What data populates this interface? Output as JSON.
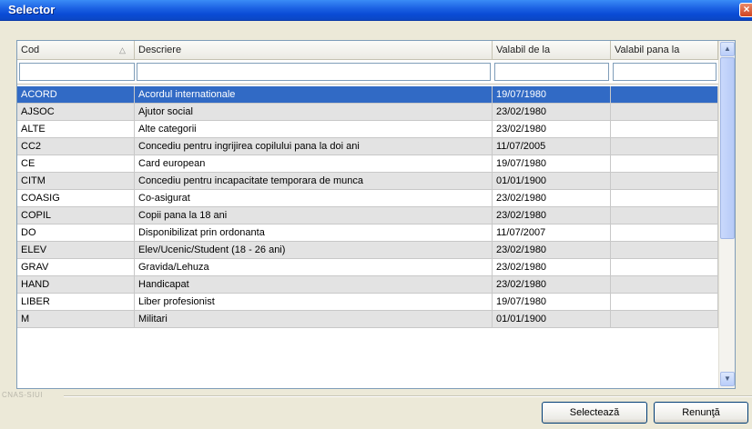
{
  "window": {
    "title": "Selector",
    "close_glyph": "×"
  },
  "table": {
    "columns": [
      {
        "label": "Cod",
        "sort": "ascending"
      },
      {
        "label": "Descriere"
      },
      {
        "label": "Valabil de la"
      },
      {
        "label": "Valabil pana la"
      }
    ],
    "filters": [
      "",
      "",
      "",
      ""
    ],
    "selected_index": 0,
    "rows": [
      {
        "cod": "ACORD",
        "descriere": "Acordul internationale",
        "de_la": "19/07/1980",
        "pana_la": ""
      },
      {
        "cod": "AJSOC",
        "descriere": "Ajutor social",
        "de_la": "23/02/1980",
        "pana_la": ""
      },
      {
        "cod": "ALTE",
        "descriere": "Alte categorii",
        "de_la": "23/02/1980",
        "pana_la": ""
      },
      {
        "cod": "CC2",
        "descriere": "Concediu pentru ingrijirea copilului pana la doi ani",
        "de_la": "11/07/2005",
        "pana_la": ""
      },
      {
        "cod": "CE",
        "descriere": "Card european",
        "de_la": "19/07/1980",
        "pana_la": ""
      },
      {
        "cod": "CITM",
        "descriere": "Concediu pentru incapacitate temporara de munca",
        "de_la": "01/01/1900",
        "pana_la": ""
      },
      {
        "cod": "COASIG",
        "descriere": "Co-asigurat",
        "de_la": "23/02/1980",
        "pana_la": ""
      },
      {
        "cod": "COPIL",
        "descriere": "Copii pana la 18 ani",
        "de_la": "23/02/1980",
        "pana_la": ""
      },
      {
        "cod": "DO",
        "descriere": "Disponibilizat prin ordonanta",
        "de_la": "11/07/2007",
        "pana_la": ""
      },
      {
        "cod": "ELEV",
        "descriere": "Elev/Ucenic/Student (18 - 26 ani)",
        "de_la": "23/02/1980",
        "pana_la": ""
      },
      {
        "cod": "GRAV",
        "descriere": "Gravida/Lehuza",
        "de_la": "23/02/1980",
        "pana_la": ""
      },
      {
        "cod": "HAND",
        "descriere": "Handicapat",
        "de_la": "23/02/1980",
        "pana_la": ""
      },
      {
        "cod": "LIBER",
        "descriere": "Liber profesionist",
        "de_la": "19/07/1980",
        "pana_la": ""
      },
      {
        "cod": "M",
        "descriere": "Militari",
        "de_la": "01/01/1900",
        "pana_la": ""
      }
    ]
  },
  "scrollbar": {
    "up_glyph": "▲",
    "down_glyph": "▼"
  },
  "status": {
    "label": "CNAS-SIUI"
  },
  "buttons": {
    "select_label": "Selectează",
    "cancel_label": "Renunţă"
  },
  "colors": {
    "title_bar": "#0a4cd6",
    "selection": "#316ac5",
    "alt_row": "#e3e3e3"
  }
}
